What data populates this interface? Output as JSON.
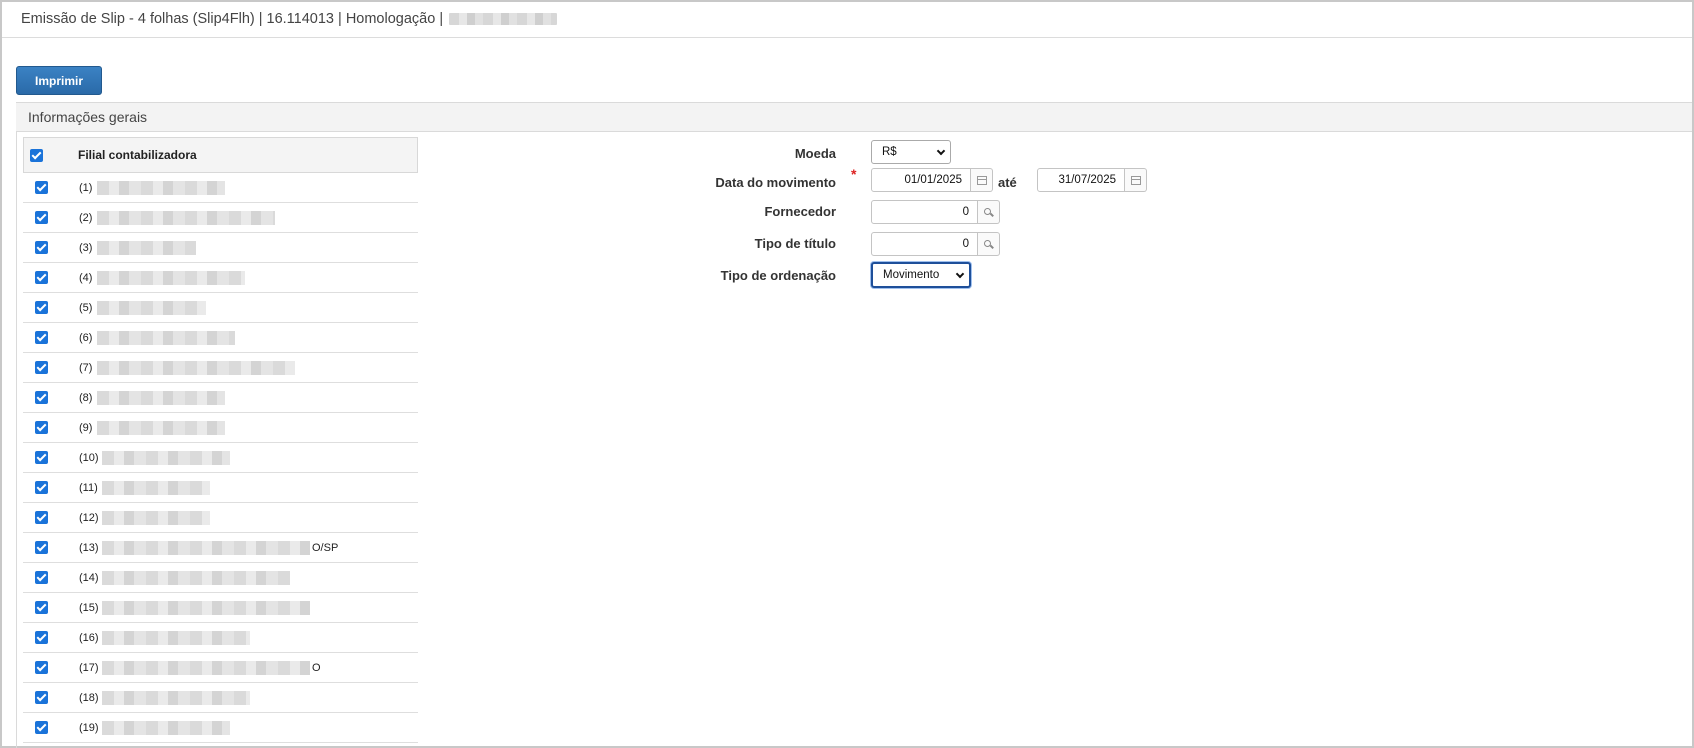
{
  "window": {
    "title": "Emissão de Slip - 4 folhas (Slip4Flh) | 16.114013 | Homologação |"
  },
  "toolbar": {
    "print_label": "Imprimir"
  },
  "section": {
    "title": "Informações gerais"
  },
  "branches": {
    "header_label": "Filial contabilizadora",
    "all_checked": true,
    "rows": [
      {
        "num": "(1)",
        "checked": true,
        "tail": ""
      },
      {
        "num": "(2)",
        "checked": true,
        "tail": ""
      },
      {
        "num": "(3)",
        "checked": true,
        "tail": ""
      },
      {
        "num": "(4)",
        "checked": true,
        "tail": ""
      },
      {
        "num": "(5)",
        "checked": true,
        "tail": ""
      },
      {
        "num": "(6)",
        "checked": true,
        "tail": ""
      },
      {
        "num": "(7)",
        "checked": true,
        "tail": ""
      },
      {
        "num": "(8)",
        "checked": true,
        "tail": ""
      },
      {
        "num": "(9)",
        "checked": true,
        "tail": ""
      },
      {
        "num": "(10)",
        "checked": true,
        "tail": ""
      },
      {
        "num": "(11)",
        "checked": true,
        "tail": ""
      },
      {
        "num": "(12)",
        "checked": true,
        "tail": ""
      },
      {
        "num": "(13)",
        "checked": true,
        "tail": "O/SP"
      },
      {
        "num": "(14)",
        "checked": true,
        "tail": ""
      },
      {
        "num": "(15)",
        "checked": true,
        "tail": ""
      },
      {
        "num": "(16)",
        "checked": true,
        "tail": ""
      },
      {
        "num": "(17)",
        "checked": true,
        "tail": "O"
      },
      {
        "num": "(18)",
        "checked": true,
        "tail": ""
      },
      {
        "num": "(19)",
        "checked": true,
        "tail": ""
      }
    ]
  },
  "form": {
    "moeda": {
      "label": "Moeda",
      "value": "R$"
    },
    "data_movimento": {
      "label": "Data do movimento",
      "required_mark": "*",
      "from": "01/01/2025",
      "to_label": "até",
      "to": "31/07/2025"
    },
    "fornecedor": {
      "label": "Fornecedor",
      "value": "0"
    },
    "tipo_titulo": {
      "label": "Tipo de título",
      "value": "0"
    },
    "tipo_ordenacao": {
      "label": "Tipo de ordenação",
      "value": "Movimento"
    }
  }
}
